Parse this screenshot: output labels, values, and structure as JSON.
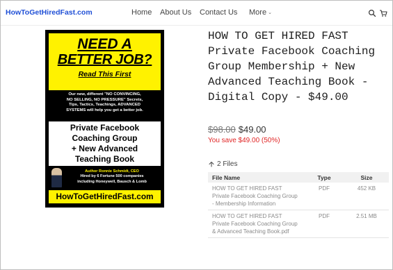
{
  "header": {
    "logo": "HowToGetHiredFast.com",
    "nav": {
      "home": "Home",
      "about": "About Us",
      "contact": "Contact Us",
      "more": "More"
    },
    "icons": [
      "search-icon",
      "cart-icon",
      "chevron-down-icon"
    ]
  },
  "cover": {
    "headline_1": "NEED A",
    "headline_2": "BETTER JOB?",
    "subhead": "Read This First",
    "blurb_1": "Our new, different \"NO CONVINCING,",
    "blurb_2": "NO SELLING, NO PRESSURE\" Secrets,",
    "blurb_3": "Tips, Tactics, Teachings, ADVANCED",
    "blurb_4": "SYSTEMS will help you get a better job.",
    "product_1": "Private Facebook",
    "product_2": "Coaching Group",
    "product_3": "+ New Advanced",
    "product_4": "Teaching Book",
    "author_1": "Author Ronnie Schmidt, CEO",
    "author_2": "Hired by 6 Fortune 500 companies",
    "author_3": "including Honeywell, Bausch & Lomb",
    "site": "HowToGetHiredFast.com"
  },
  "product": {
    "title": "HOW TO GET HIRED FAST Private Facebook Coaching Group Membership + New Advanced Teaching Book - Digital Copy - $49.00",
    "old_price": "$98.00",
    "price": "$49.00",
    "savings": "You save $49.00 (50%)",
    "files_count": "2 Files"
  },
  "files_table": {
    "headers": {
      "name": "File Name",
      "type": "Type",
      "size": "Size"
    },
    "rows": [
      {
        "name": "HOW TO GET HIRED FAST Private Facebook Coaching Group - Membership Information",
        "type": "PDF",
        "size": "452 KB"
      },
      {
        "name": "HOW TO GET HIRED FAST Private Facebook Coaching Group & Advanced Teaching Book.pdf",
        "type": "PDF",
        "size": "2.51 MB"
      }
    ]
  },
  "colors": {
    "logo": "#1f4fd6",
    "cover_yellow": "#fff200",
    "savings_red": "#e02424"
  }
}
